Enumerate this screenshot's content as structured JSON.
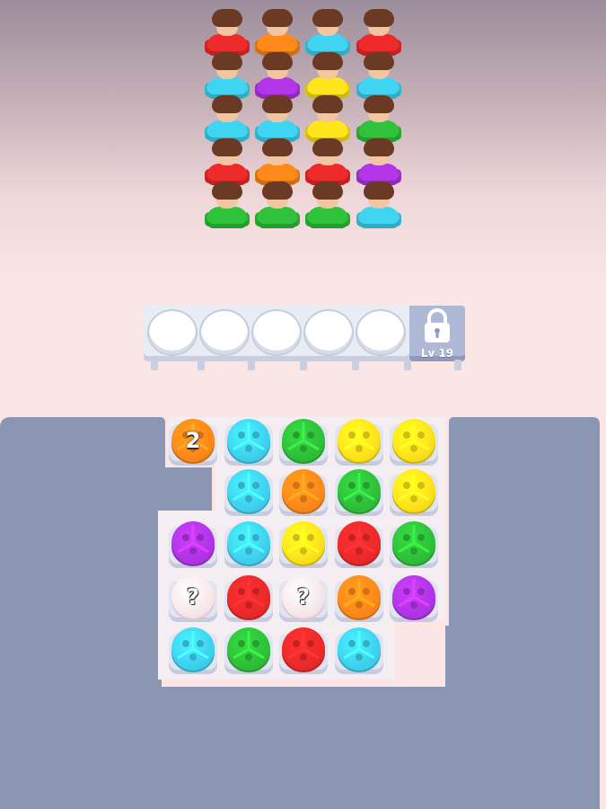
{
  "bench": {
    "slot_count": 5,
    "lock_label": "Lv 19"
  },
  "crowd": {
    "columns": [
      [
        "red",
        "cyan",
        "cyan",
        "red",
        "green"
      ],
      [
        "orange",
        "purple",
        "cyan",
        "orange",
        "green"
      ],
      [
        "cyan",
        "yellow",
        "yellow",
        "red",
        "green"
      ],
      [
        "red",
        "cyan",
        "green",
        "purple",
        "cyan"
      ]
    ]
  },
  "grid": {
    "rows": [
      [
        {
          "color": "orange",
          "label": "2"
        },
        {
          "color": "cyan"
        },
        {
          "color": "green"
        },
        {
          "color": "yellow"
        },
        {
          "color": "yellow"
        }
      ],
      [
        null,
        {
          "color": "cyan"
        },
        {
          "color": "orange"
        },
        {
          "color": "green"
        },
        {
          "color": "yellow"
        }
      ],
      [
        {
          "color": "purple"
        },
        {
          "color": "cyan"
        },
        {
          "color": "yellow"
        },
        {
          "color": "red"
        },
        {
          "color": "green"
        }
      ],
      [
        {
          "color": "hidden",
          "label": "?"
        },
        {
          "color": "red"
        },
        {
          "color": "hidden",
          "label": "?"
        },
        {
          "color": "orange"
        },
        {
          "color": "purple"
        }
      ],
      [
        {
          "color": "cyan"
        },
        {
          "color": "green"
        },
        {
          "color": "red"
        },
        {
          "color": "cyan"
        },
        null
      ]
    ]
  },
  "palette": {
    "red": "#ee2a2a",
    "orange": "#ff8a1a",
    "yellow": "#ffe51c",
    "green": "#2fc23a",
    "cyan": "#3fd4f2",
    "purple": "#b335e8",
    "hidden": "#f6e8ea",
    "board": "#8a96b4",
    "tile_base": "#e1e5f1",
    "skin": "#f2c6a0",
    "hair": "#6b3a24"
  }
}
